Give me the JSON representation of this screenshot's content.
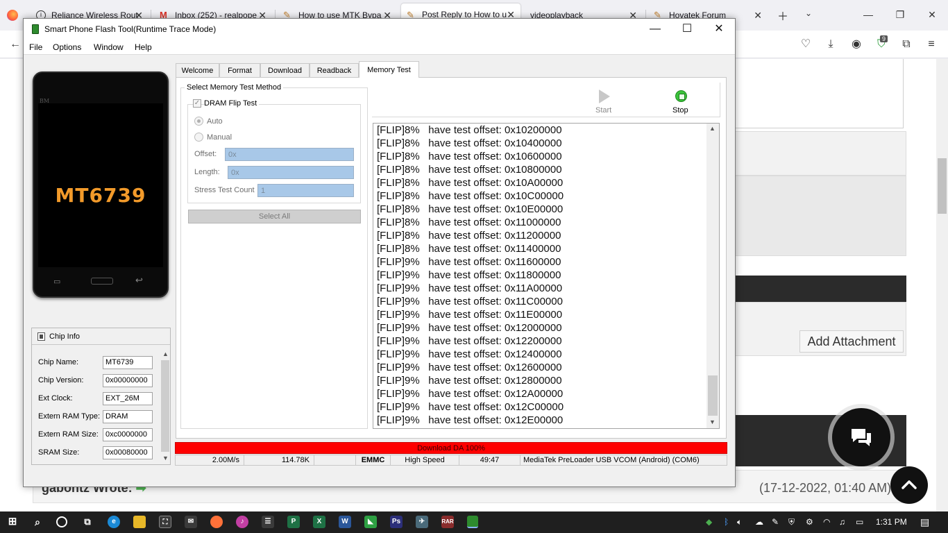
{
  "browser": {
    "tabs": [
      {
        "label": "Reliance Wireless Rout",
        "icon": "info-icon",
        "color": "#333333"
      },
      {
        "label": "Inbox (252) - realpope",
        "icon": "gmail-icon",
        "color": "#d93025"
      },
      {
        "label": "How to use MTK Bypa",
        "icon": "hovatek-icon",
        "color": "#c08030"
      },
      {
        "label": "Post Reply to How to u",
        "icon": "hovatek-icon",
        "color": "#c08030"
      },
      {
        "label": "videoplayback",
        "icon": "",
        "color": ""
      },
      {
        "label": "Hovatek Forum",
        "icon": "hovatek-icon",
        "color": "#c08030"
      }
    ],
    "extension_badge": "9"
  },
  "webpage": {
    "add_attachment": "Add Attachment",
    "quote_author": "gabontz Wrote:",
    "quote_date": "(17-12-2022, 01:40 AM)"
  },
  "tool": {
    "title": "Smart Phone Flash Tool(Runtime Trace Mode)",
    "menu": [
      "File",
      "Options",
      "Window",
      "Help"
    ],
    "phone": {
      "brand": "BM",
      "model": "MT6739"
    },
    "chip_info": {
      "title": "Chip Info",
      "rows": [
        {
          "label": "Chip Name:",
          "value": "MT6739"
        },
        {
          "label": "Chip Version:",
          "value": "0x00000000"
        },
        {
          "label": "Ext Clock:",
          "value": "EXT_26M"
        },
        {
          "label": "Extern RAM Type:",
          "value": "DRAM"
        },
        {
          "label": "Extern RAM Size:",
          "value": "0xc0000000"
        },
        {
          "label": "SRAM Size:",
          "value": "0x00080000"
        }
      ]
    },
    "tabs": [
      "Welcome",
      "Format",
      "Download",
      "Readback",
      "Memory Test"
    ],
    "active_tab": "Memory Test",
    "memory_test": {
      "group_title": "Select Memory Test Method",
      "dram_flip": {
        "label": "DRAM Flip Test",
        "checked": true
      },
      "auto_label": "Auto",
      "manual_label": "Manual",
      "offset_label": "Offset:",
      "offset_value": "0x",
      "length_label": "Length:",
      "length_value": "0x",
      "stress_label": "Stress Test Count",
      "stress_value": "1",
      "select_all": "Select All",
      "start_label": "Start",
      "stop_label": "Stop"
    },
    "log": [
      "[FLIP]8%   have test offset: 0x10200000",
      "[FLIP]8%   have test offset: 0x10400000",
      "[FLIP]8%   have test offset: 0x10600000",
      "[FLIP]8%   have test offset: 0x10800000",
      "[FLIP]8%   have test offset: 0x10A00000",
      "[FLIP]8%   have test offset: 0x10C00000",
      "[FLIP]8%   have test offset: 0x10E00000",
      "[FLIP]8%   have test offset: 0x11000000",
      "[FLIP]8%   have test offset: 0x11200000",
      "[FLIP]8%   have test offset: 0x11400000",
      "[FLIP]9%   have test offset: 0x11600000",
      "[FLIP]9%   have test offset: 0x11800000",
      "[FLIP]9%   have test offset: 0x11A00000",
      "[FLIP]9%   have test offset: 0x11C00000",
      "[FLIP]9%   have test offset: 0x11E00000",
      "[FLIP]9%   have test offset: 0x12000000",
      "[FLIP]9%   have test offset: 0x12200000",
      "[FLIP]9%   have test offset: 0x12400000",
      "[FLIP]9%   have test offset: 0x12600000",
      "[FLIP]9%   have test offset: 0x12800000",
      "[FLIP]9%   have test offset: 0x12A00000",
      "[FLIP]9%   have test offset: 0x12C00000",
      "[FLIP]9%   have test offset: 0x12E00000"
    ],
    "progress": {
      "text": "Download DA 100%",
      "percent": 100,
      "color": "#fe0000"
    },
    "status": {
      "speed": "2.00M/s",
      "size": "114.78K",
      "blank": "",
      "storage": "EMMC",
      "mode": "High Speed",
      "time": "49:47",
      "port": "MediaTek PreLoader USB VCOM (Android) (COM6)"
    }
  },
  "taskbar": {
    "time": "1:31 PM"
  }
}
